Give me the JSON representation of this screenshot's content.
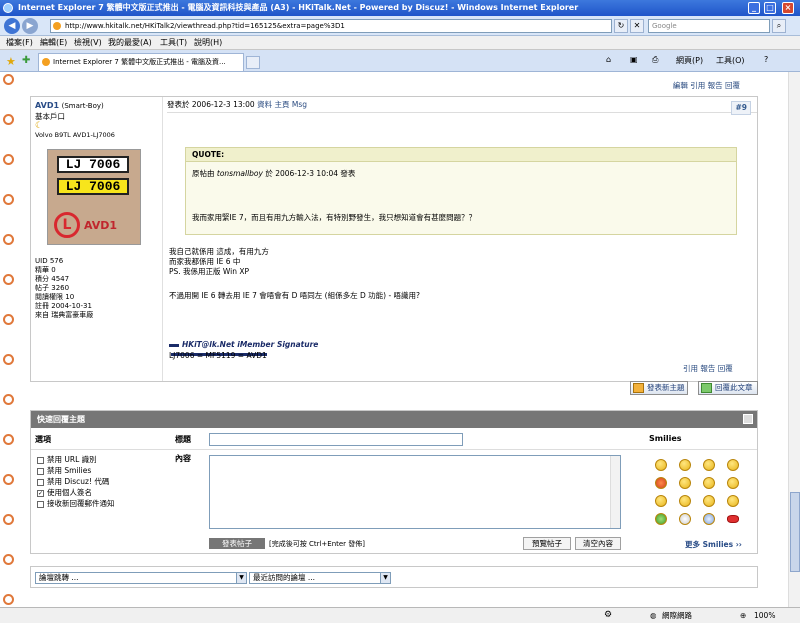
{
  "window": {
    "title": "Internet Explorer 7 繁體中文版正式推出 - 電腦及資訊科技與產品 (A3) - HKiTalk.Net - Powered by Discuz! - Windows Internet Explorer",
    "min": "_",
    "max": "□",
    "close": "×"
  },
  "address": {
    "url": "http://www.hkitalk.net/HKiTalk2/viewthread.php?tid=165125&extra=page%3D1",
    "search_placeholder": "Google"
  },
  "menu": [
    "檔案(F)",
    "編輯(E)",
    "檢視(V)",
    "我的最愛(A)",
    "工具(T)",
    "說明(H)"
  ],
  "tab": {
    "label": "Internet Explorer 7 繁體中文版正式推出 - 電腦及資..."
  },
  "commandbar": {
    "page": "網頁(P)",
    "tools": "工具(O)"
  },
  "post": {
    "top_actions": "編輯 引用 報告 回覆",
    "author": "AVD1",
    "author_nick": "(Smart-Boy)",
    "rank": "基本戶口",
    "car": "Volvo B9TL AVD1-LJ7006",
    "avatar": {
      "plate1": "LJ 7006",
      "plate2": "LJ 7006",
      "logo_letter": "L",
      "logo_text": "AVD1"
    },
    "stats": [
      {
        "label": "UID",
        "value": "576"
      },
      {
        "label": "精華",
        "value": "0"
      },
      {
        "label": "積分",
        "value": "4547"
      },
      {
        "label": "帖子",
        "value": "3260"
      },
      {
        "label": "閱讀權限",
        "value": "10"
      },
      {
        "label": "註冊",
        "value": "2004-10-31"
      },
      {
        "label": "來自",
        "value": "瑞典富豪車廠"
      }
    ],
    "posted_prefix": "發表於",
    "posted_time": "2006-12-3 13:00",
    "header_links": "資料 主頁 Msg",
    "floor": "#9",
    "quote": {
      "title": "QUOTE:",
      "by_prefix": "原帖由",
      "by_user": "tonsmallboy",
      "by_suffix": "於 2006-12-3 10:04 發表",
      "text": "我而家用緊IE 7，而且有用九方輸入法，有特別野發生，我只想知道會有甚麼問題？？"
    },
    "body": [
      "我自己就係用 這成，有用九方",
      "而家我都係用 IE 6 中",
      "PS. 我係用正版 Win XP",
      "不過用開 IE 6 轉去用 IE 7 會唔會有 D 唔同左 (組係多左 D 功能) - 唔識用?"
    ],
    "signature_title": "HKiT@lk.Net iMember Signature",
    "signature_line": "LJ7006 = MF5119 = AVD1",
    "bottom_actions": "引用 報告 回覆"
  },
  "buttons": {
    "new_topic": "發表新主題",
    "reply": "回覆此文章"
  },
  "quickreply": {
    "title": "快速回覆主題",
    "options_label": "選項",
    "subject_label": "標題",
    "content_label": "內容",
    "smilies_label": "Smilies",
    "options": [
      {
        "label": "禁用 URL 識別",
        "checked": false
      },
      {
        "label": "禁用 Smilies",
        "checked": false
      },
      {
        "label": "禁用 Discuz! 代碼",
        "checked": false
      },
      {
        "label": "使用個人簽名",
        "checked": true
      },
      {
        "label": "接收新回覆郵件通知",
        "checked": false
      }
    ],
    "send": "發表帖子",
    "send_hint": "[完成後可按 Ctrl+Enter 發佈]",
    "preview": "預覽帖子",
    "clear": "清空內容",
    "more_smilies": "更多 Smilies ››"
  },
  "jump": {
    "forum": "論壇跳轉 ...",
    "recent": "最近訪問的論壇 ..."
  },
  "status": {
    "zone": "網際網路",
    "zoom": "100%"
  }
}
